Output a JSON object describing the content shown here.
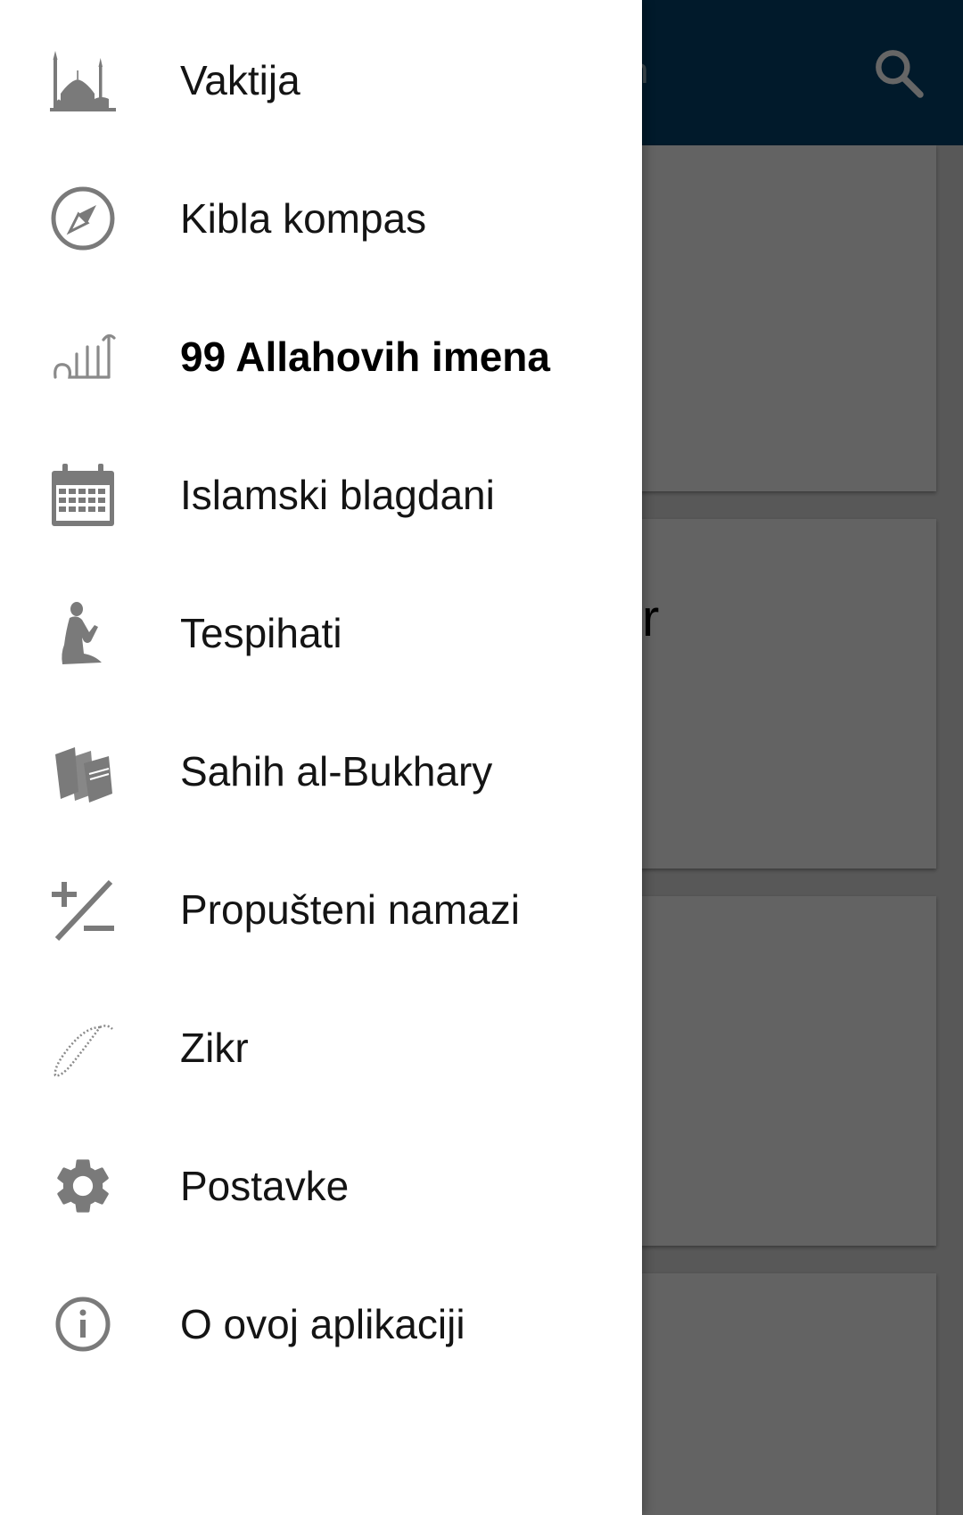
{
  "app": {
    "appbar_title_fragment": "n",
    "card_text_fragment": "r",
    "appbar_color": "#03426b",
    "search_icon": "search-icon"
  },
  "drawer": {
    "active_index": 2,
    "items": [
      {
        "label": "Vaktija",
        "icon": "mosque-icon"
      },
      {
        "label": "Kibla kompas",
        "icon": "compass-icon"
      },
      {
        "label": "99 Allahovih imena",
        "icon": "allah-calligraphy-icon"
      },
      {
        "label": "Islamski blagdani",
        "icon": "calendar-icon"
      },
      {
        "label": "Tespihati",
        "icon": "praying-person-icon"
      },
      {
        "label": "Sahih al-Bukhary",
        "icon": "books-icon"
      },
      {
        "label": "Propušteni namazi",
        "icon": "plus-minus-icon"
      },
      {
        "label": "Zikr",
        "icon": "prayer-beads-icon"
      },
      {
        "label": "Postavke",
        "icon": "gear-icon"
      },
      {
        "label": "O ovoj aplikaciji",
        "icon": "info-icon"
      }
    ]
  }
}
